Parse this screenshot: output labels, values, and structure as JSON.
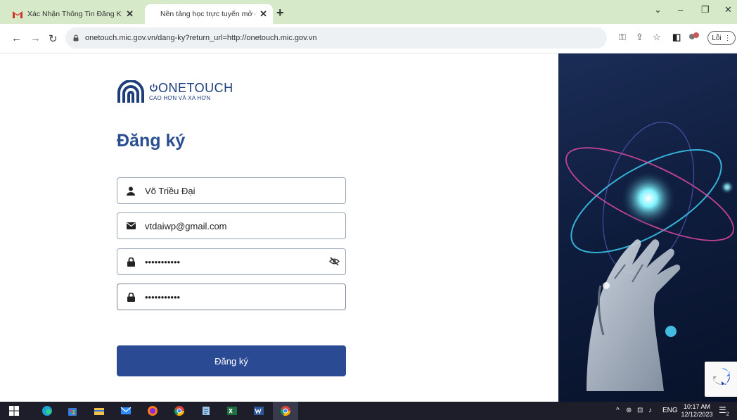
{
  "browser": {
    "tabs": [
      {
        "title": "Xác Nhận Thông Tin Đăng Ký - v",
        "active": false
      },
      {
        "title": "Nền tảng học trực tuyến mở đại",
        "active": true
      }
    ],
    "new_tab": "+",
    "window_controls": {
      "dropdown": "⌄",
      "minimize": "–",
      "restore": "❐",
      "close": "✕"
    },
    "url": "onetouch.mic.gov.vn/dang-ky?return_url=http://onetouch.mic.gov.vn",
    "error_button": "Lỗi"
  },
  "page": {
    "logo": {
      "name": "ONETOUCH",
      "tagline": "CAO HƠN VÀ XA HƠN"
    },
    "title": "Đăng ký",
    "form": {
      "name_value": "Võ Triều Đại",
      "email_value": "vtdaiwp@gmail.com",
      "password_value": "•••••••••••",
      "confirm_value": "•••••••••••",
      "submit_label": "Đăng ký"
    }
  },
  "taskbar": {
    "language": "ENG",
    "time": "10:17 AM",
    "date": "12/12/2023",
    "notification_count": "2"
  },
  "colors": {
    "brand_blue": "#2a4a93",
    "tabstrip": "#d6e9c9",
    "taskbar": "#1e1e2b"
  }
}
